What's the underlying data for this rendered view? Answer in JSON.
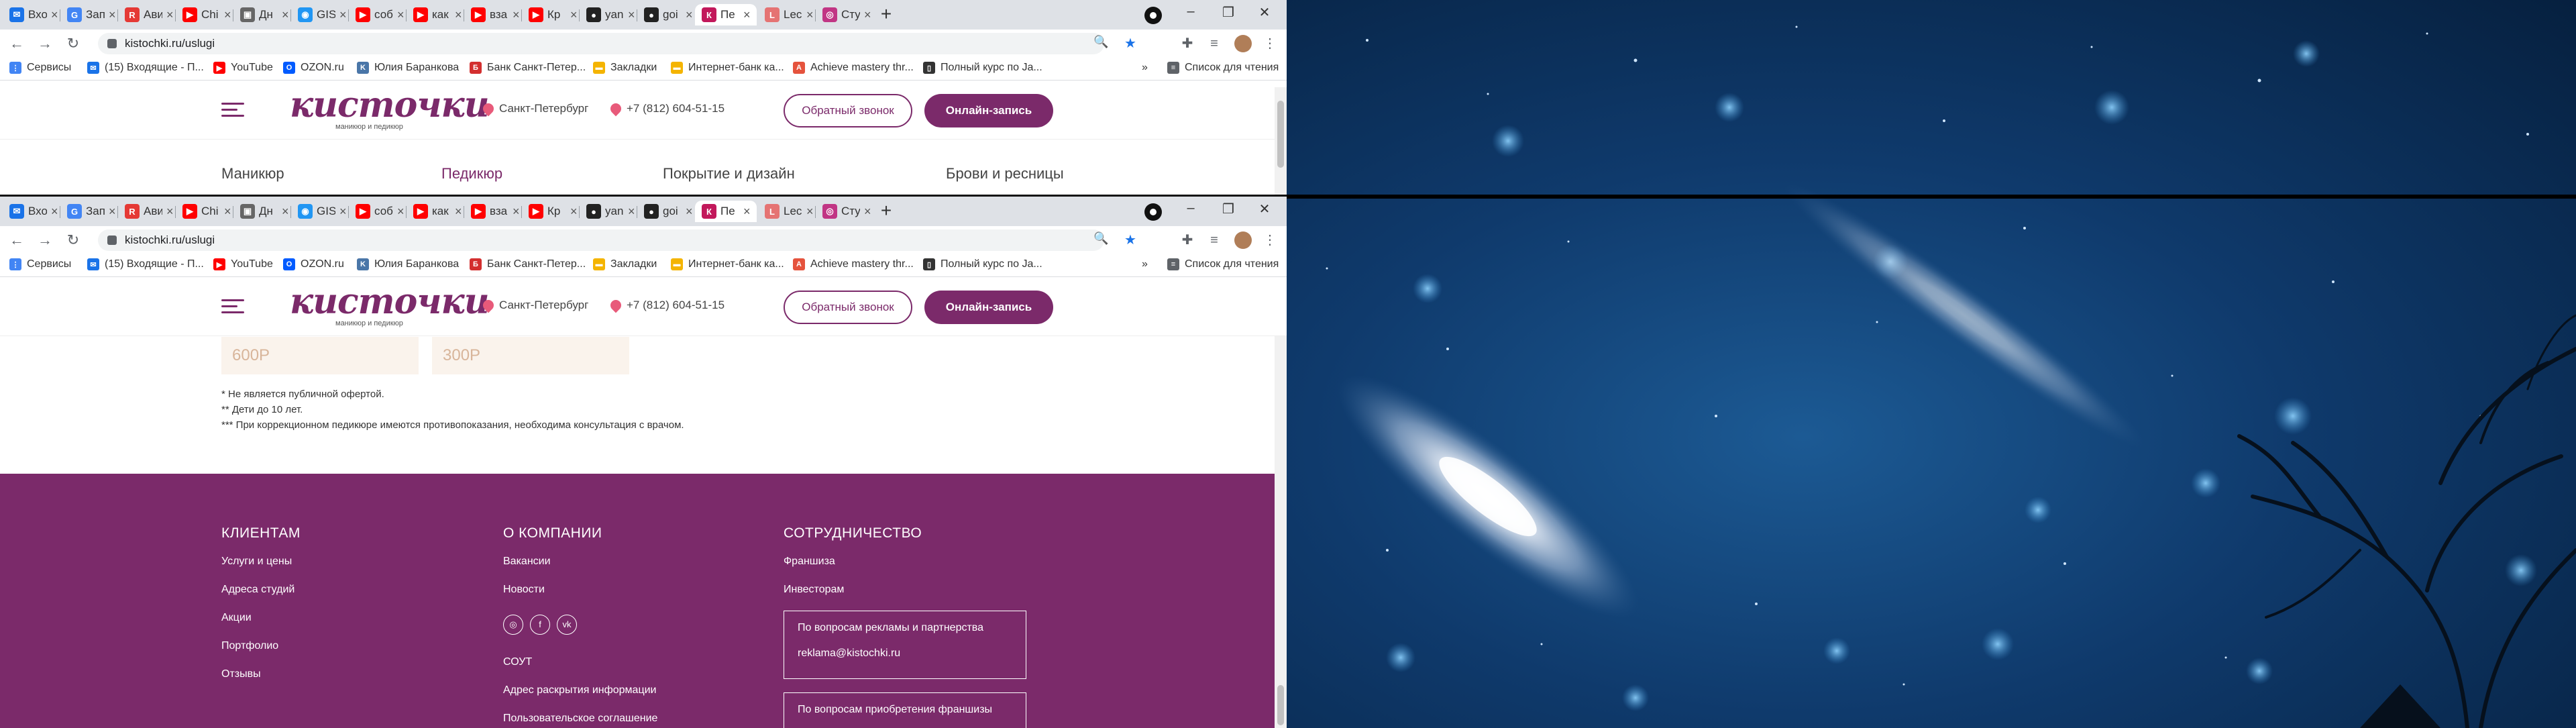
{
  "browser": {
    "tabs": [
      {
        "label": "Вхо",
        "color": "#1a73e8",
        "icon": "mail-icon"
      },
      {
        "label": "Зап",
        "color": "#4285f4",
        "icon": "google-icon"
      },
      {
        "label": "Ави",
        "color": "#e53935",
        "icon": "avito-icon"
      },
      {
        "label": "Chi",
        "color": "#ff0000",
        "icon": "youtube-icon"
      },
      {
        "label": "Дн",
        "color": "#666666",
        "icon": "image-icon"
      },
      {
        "label": "GIS",
        "color": "#2196f3",
        "icon": "gis-icon"
      },
      {
        "label": "соб",
        "color": "#ff0000",
        "icon": "youtube-icon"
      },
      {
        "label": "как",
        "color": "#ff0000",
        "icon": "youtube-icon"
      },
      {
        "label": "вза",
        "color": "#ff0000",
        "icon": "youtube-icon"
      },
      {
        "label": "Кр",
        "color": "#ff0000",
        "icon": "youtube-icon"
      },
      {
        "label": "yan",
        "color": "#222222",
        "icon": "github-icon"
      },
      {
        "label": "goi",
        "color": "#222222",
        "icon": "github-icon"
      },
      {
        "label": "Пе",
        "color": "#c2185b",
        "icon": "kistochki-icon",
        "active": true
      },
      {
        "label": "Lec",
        "color": "#e57373",
        "icon": "lecture-icon"
      },
      {
        "label": "Сту",
        "color": "#c13584",
        "icon": "instagram-icon"
      }
    ],
    "url": "kistochki.ru/uslugi",
    "bookmarks": [
      {
        "label": "Сервисы",
        "color": "#4285f4"
      },
      {
        "label": "(15) Входящие - П...",
        "color": "#1a73e8"
      },
      {
        "label": "YouTube",
        "color": "#ff0000"
      },
      {
        "label": "OZON.ru",
        "color": "#005bff"
      },
      {
        "label": "Юлия Баранкова",
        "color": "#4a76a8"
      },
      {
        "label": "Банк Санкт-Петер...",
        "color": "#d32f2f"
      },
      {
        "label": "Закладки",
        "color": "#f4b400"
      },
      {
        "label": "Интернет-банк ка...",
        "color": "#f4b400"
      },
      {
        "label": "Achieve mastery thr...",
        "color": "#e5533d"
      },
      {
        "label": "Полный курс по Ja...",
        "color": "#333333"
      }
    ],
    "more": "»",
    "reading_list": "Список для чтения"
  },
  "site": {
    "logo": "кисточки",
    "logo_sub": "маникюр и педикюр",
    "city": "Санкт-Петербург",
    "phone": "+7 (812) 604-51-15",
    "callback": "Обратный звонок",
    "booking": "Онлайн-запись",
    "services": [
      "Маникюр",
      "Педикюр",
      "Покрытие и дизайн",
      "Брови и ресницы"
    ],
    "prices": [
      "600Р",
      "300Р"
    ],
    "notes": [
      "* Не является публичной офертой.",
      "** Дети до 10 лет.",
      "*** При коррекционном педикюре имеются противопоказания, необходима консультация с врачом."
    ],
    "footer": {
      "col1_title": "КЛИЕНТАМ",
      "col1": [
        "Услуги и цены",
        "Адреса студий",
        "Акции",
        "Портфолио",
        "Отзывы"
      ],
      "col2_title": "О КОМПАНИИ",
      "col2": [
        "Вакансии",
        "Новости"
      ],
      "col2_bottom": [
        "СОУТ",
        "Адрес раскрытия информации",
        "Пользовательское соглашение"
      ],
      "col3_title": "СОТРУДНИЧЕСТВО",
      "col3": [
        "Франшиза",
        "Инвесторам"
      ],
      "box1_title": "По вопросам рекламы и партнерства",
      "box1_email": "reklama@kistochki.ru",
      "box2_title": "По вопросам приобретения франшизы"
    }
  },
  "desktop": {
    "wallpaper": "galaxy-night-sky",
    "colors": {
      "sky": "#0f3a6c",
      "galaxy": "#ffffff",
      "tree": "#06101c"
    }
  }
}
